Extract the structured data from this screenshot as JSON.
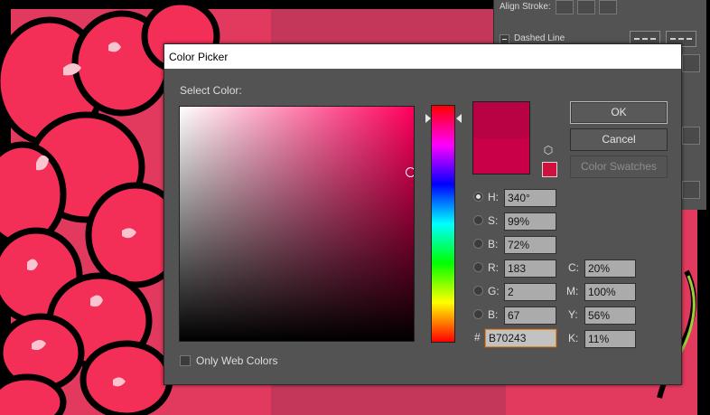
{
  "app_panel": {
    "stroke_label": "Align Stroke:",
    "dashed_line_label": "Dashed Line"
  },
  "dialog": {
    "title": "Color Picker",
    "select_color_label": "Select Color:",
    "current_hex_color": "#B70243",
    "previous_hex_color": "#C90048",
    "hue_base_color": "#ff005c",
    "out_of_gamut_color": "#D0103F",
    "buttons": {
      "ok": "OK",
      "cancel": "Cancel",
      "swatches": "Color Swatches"
    },
    "fields": {
      "H": {
        "label": "H:",
        "value": "340°",
        "selected": true
      },
      "S": {
        "label": "S:",
        "value": "99%"
      },
      "B_hsb": {
        "label": "B:",
        "value": "72%"
      },
      "R": {
        "label": "R:",
        "value": "183"
      },
      "G": {
        "label": "G:",
        "value": "2"
      },
      "B_rgb": {
        "label": "B:",
        "value": "67"
      },
      "hex": {
        "label": "#",
        "value": "B70243"
      },
      "C": {
        "label": "C:",
        "value": "20%"
      },
      "M": {
        "label": "M:",
        "value": "100%"
      },
      "Y": {
        "label": "Y:",
        "value": "56%"
      },
      "K": {
        "label": "K:",
        "value": "11%"
      }
    },
    "only_web_colors_label": "Only Web Colors",
    "only_web_colors_checked": false,
    "sv_marker": {
      "saturation": 0.99,
      "brightness": 0.72
    },
    "hue_slider_fraction": 0.056
  },
  "icons": {
    "gamut_warning": "cube-icon",
    "panel_checkbox": "minus-icon"
  }
}
